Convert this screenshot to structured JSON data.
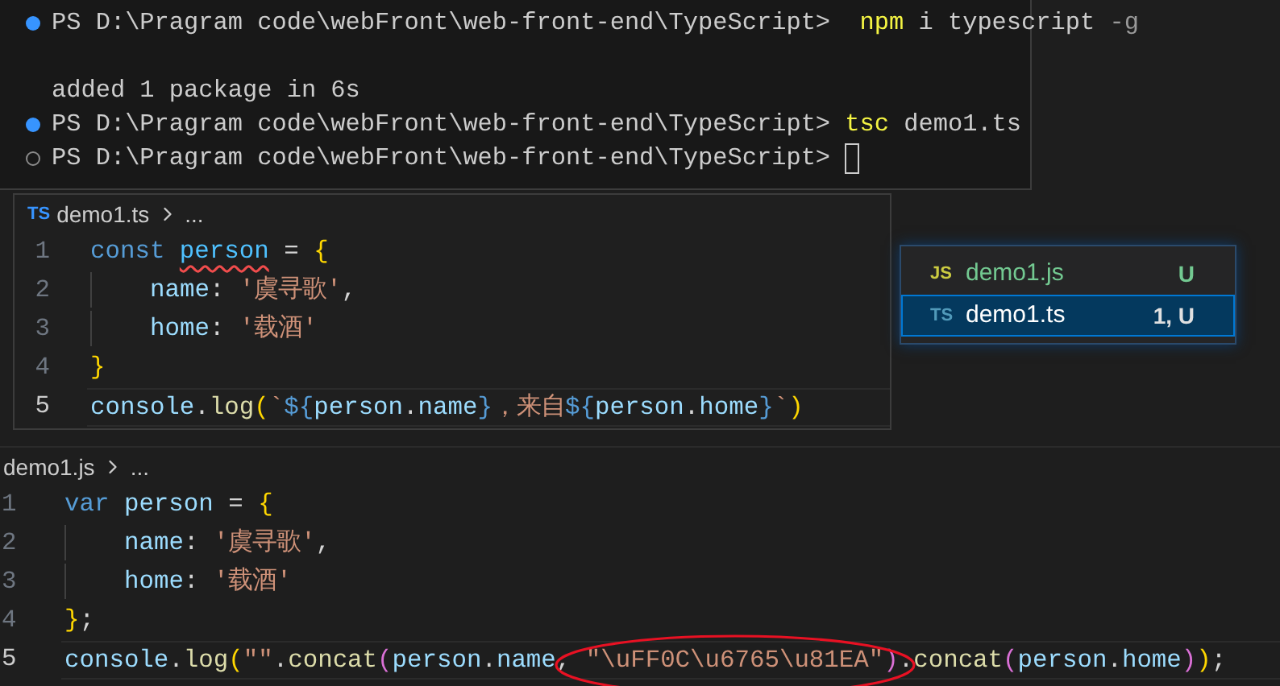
{
  "terminal": {
    "lines": [
      {
        "marker": {
          "filled": true
        },
        "cursor": false,
        "tokens": [
          {
            "text": "PS D:\\Pragram code\\webFront\\web-front-end\\TypeScript>  ",
            "kind": "prompt"
          },
          {
            "text": "npm",
            "kind": "command"
          },
          {
            "text": " i typescript ",
            "kind": "arg"
          },
          {
            "text": "-g",
            "kind": "flag"
          }
        ]
      },
      {
        "cursor": false,
        "tokens": [
          {
            "text": "added 1 package in 6s",
            "kind": "output"
          }
        ]
      },
      {
        "marker": {
          "filled": true
        },
        "cursor": false,
        "tokens": [
          {
            "text": "PS D:\\Pragram code\\webFront\\web-front-end\\TypeScript> ",
            "kind": "prompt"
          },
          {
            "text": "tsc",
            "kind": "command"
          },
          {
            "text": " demo1.ts",
            "kind": "arg"
          }
        ]
      },
      {
        "marker": {
          "filled": false
        },
        "cursor": true,
        "tokens": [
          {
            "text": "PS D:\\Pragram code\\webFront\\web-front-end\\TypeScript> ",
            "kind": "prompt"
          }
        ]
      }
    ]
  },
  "ts_editor": {
    "breadcrumb": {
      "badge": "TS",
      "file": "demo1.ts",
      "rest": "..."
    },
    "lines": [
      {
        "number": "1",
        "active": false,
        "indented": false,
        "tokens": [
          {
            "text": "const ",
            "kind": "keyword"
          },
          {
            "text": "person",
            "kind": "variable",
            "error": true
          },
          {
            "text": " = ",
            "kind": "punct"
          },
          {
            "text": "{",
            "kind": "brace1"
          }
        ]
      },
      {
        "number": "2",
        "active": false,
        "indented": true,
        "tokens": [
          {
            "text": "name",
            "kind": "property"
          },
          {
            "text": ": ",
            "kind": "punct"
          },
          {
            "text": "'虞寻歌'",
            "kind": "string"
          },
          {
            "text": ",",
            "kind": "punct"
          }
        ]
      },
      {
        "number": "3",
        "active": false,
        "indented": true,
        "tokens": [
          {
            "text": "home",
            "kind": "property"
          },
          {
            "text": ": ",
            "kind": "punct"
          },
          {
            "text": "'载酒'",
            "kind": "string"
          }
        ]
      },
      {
        "number": "4",
        "active": false,
        "indented": false,
        "tokens": [
          {
            "text": "}",
            "kind": "brace1"
          }
        ]
      },
      {
        "number": "5",
        "active": true,
        "indented": false,
        "tokens": [
          {
            "text": "console",
            "kind": "property"
          },
          {
            "text": ".",
            "kind": "punct"
          },
          {
            "text": "log",
            "kind": "func"
          },
          {
            "text": "(",
            "kind": "brace1"
          },
          {
            "text": "`",
            "kind": "string"
          },
          {
            "text": "${",
            "kind": "template"
          },
          {
            "text": "person",
            "kind": "property"
          },
          {
            "text": ".",
            "kind": "punct"
          },
          {
            "text": "name",
            "kind": "property"
          },
          {
            "text": "}",
            "kind": "template"
          },
          {
            "text": "，来自",
            "kind": "string"
          },
          {
            "text": "${",
            "kind": "template"
          },
          {
            "text": "person",
            "kind": "property"
          },
          {
            "text": ".",
            "kind": "punct"
          },
          {
            "text": "home",
            "kind": "property"
          },
          {
            "text": "}",
            "kind": "template"
          },
          {
            "text": "`",
            "kind": "string"
          },
          {
            "text": ")",
            "kind": "brace1"
          }
        ]
      }
    ]
  },
  "file_list": [
    {
      "badge": "JS",
      "name": "demo1.js",
      "status": "U",
      "selected": false
    },
    {
      "badge": "TS",
      "name": "demo1.ts",
      "status": "1, U",
      "selected": true
    }
  ],
  "js_editor": {
    "breadcrumb": {
      "file": "demo1.js",
      "rest": "..."
    },
    "lines": [
      {
        "number": "1",
        "active": false,
        "indented": false,
        "tokens": [
          {
            "text": "var ",
            "kind": "keyword"
          },
          {
            "text": "person",
            "kind": "property"
          },
          {
            "text": " = ",
            "kind": "punct"
          },
          {
            "text": "{",
            "kind": "brace1"
          }
        ]
      },
      {
        "number": "2",
        "active": false,
        "indented": true,
        "tokens": [
          {
            "text": "name",
            "kind": "property"
          },
          {
            "text": ": ",
            "kind": "punct"
          },
          {
            "text": "'虞寻歌'",
            "kind": "string"
          },
          {
            "text": ",",
            "kind": "punct"
          }
        ]
      },
      {
        "number": "3",
        "active": false,
        "indented": true,
        "tokens": [
          {
            "text": "home",
            "kind": "property"
          },
          {
            "text": ": ",
            "kind": "punct"
          },
          {
            "text": "'载酒'",
            "kind": "string"
          }
        ]
      },
      {
        "number": "4",
        "active": false,
        "indented": false,
        "tokens": [
          {
            "text": "}",
            "kind": "brace1"
          },
          {
            "text": ";",
            "kind": "punct"
          }
        ]
      },
      {
        "number": "5",
        "active": true,
        "indented": false,
        "tokens": [
          {
            "text": "console",
            "kind": "property"
          },
          {
            "text": ".",
            "kind": "punct"
          },
          {
            "text": "log",
            "kind": "func"
          },
          {
            "text": "(",
            "kind": "brace1"
          },
          {
            "text": "\"\"",
            "kind": "string"
          },
          {
            "text": ".",
            "kind": "punct"
          },
          {
            "text": "concat",
            "kind": "func"
          },
          {
            "text": "(",
            "kind": "brace2"
          },
          {
            "text": "person",
            "kind": "property"
          },
          {
            "text": ".",
            "kind": "punct"
          },
          {
            "text": "name",
            "kind": "property"
          },
          {
            "text": ", ",
            "kind": "punct"
          },
          {
            "text": "\"\\uFF0C\\u6765\\u81EA\"",
            "kind": "string",
            "circled": true
          },
          {
            "text": ")",
            "kind": "brace2"
          },
          {
            "text": ".",
            "kind": "punct"
          },
          {
            "text": "concat",
            "kind": "func"
          },
          {
            "text": "(",
            "kind": "brace2"
          },
          {
            "text": "person",
            "kind": "property"
          },
          {
            "text": ".",
            "kind": "punct"
          },
          {
            "text": "home",
            "kind": "property"
          },
          {
            "text": ")",
            "kind": "brace2"
          },
          {
            "text": ")",
            "kind": "brace1"
          },
          {
            "text": ";",
            "kind": "punct"
          }
        ]
      }
    ]
  }
}
